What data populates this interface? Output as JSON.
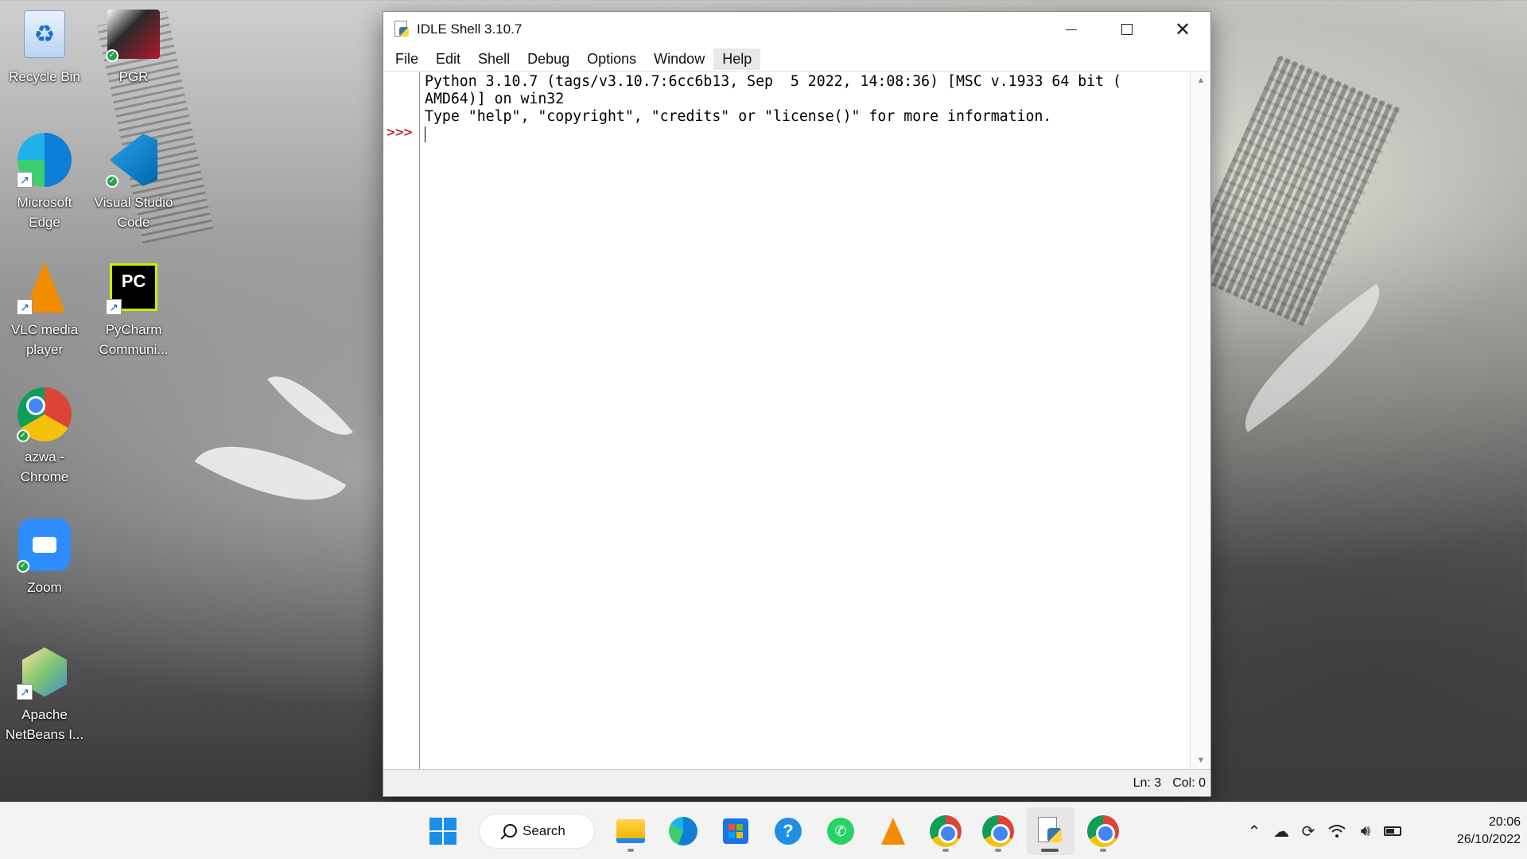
{
  "desktop": {
    "icons": [
      {
        "label": "Recycle Bin"
      },
      {
        "label": "PGR"
      },
      {
        "label": "Microsoft Edge"
      },
      {
        "label": "Visual Studio Code"
      },
      {
        "label": "VLC media player"
      },
      {
        "label": "PyCharm Communi..."
      },
      {
        "label": "azwa - Chrome"
      },
      {
        "label": "Zoom"
      },
      {
        "label": "Apache NetBeans I..."
      }
    ]
  },
  "window": {
    "title": "IDLE Shell 3.10.7",
    "menu": [
      "File",
      "Edit",
      "Shell",
      "Debug",
      "Options",
      "Window",
      "Help"
    ],
    "shell_lines": [
      "Python 3.10.7 (tags/v3.10.7:6cc6b13, Sep  5 2022, 14:08:36) [MSC v.1933 64 bit (",
      "AMD64)] on win32",
      "Type \"help\", \"copyright\", \"credits\" or \"license()\" for more information."
    ],
    "prompt": ">>>",
    "status": {
      "line": "Ln: 3",
      "col": "Col: 0"
    }
  },
  "taskbar": {
    "search_label": "Search",
    "apps": [
      "windows-start-icon",
      "file-explorer-icon",
      "edge-icon",
      "microsoft-store-icon",
      "help-messages-icon",
      "whatsapp-icon",
      "vlc-icon",
      "chrome-profile-icon",
      "chrome-profile2-icon",
      "idle-python-icon",
      "chrome-icon"
    ],
    "tray": [
      "show-hidden-icons-chevron",
      "onedrive-icon",
      "sync-icon",
      "wifi-icon",
      "volume-icon",
      "battery-icon"
    ],
    "time": "20:06",
    "date": "26/10/2022"
  },
  "colors": {
    "prompt": "#c00000",
    "taskbar_bg": "#f3f3f3"
  }
}
